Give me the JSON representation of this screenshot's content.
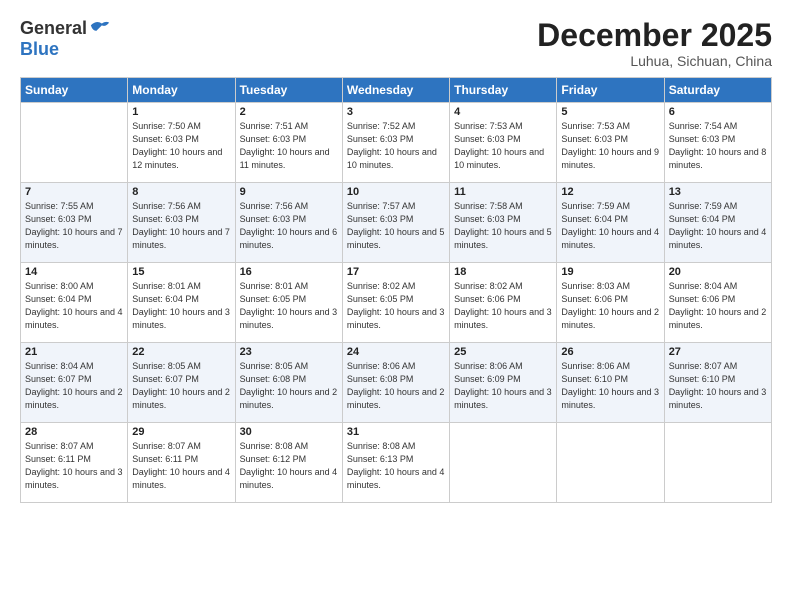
{
  "logo": {
    "general": "General",
    "blue": "Blue"
  },
  "title": "December 2025",
  "location": "Luhua, Sichuan, China",
  "headers": [
    "Sunday",
    "Monday",
    "Tuesday",
    "Wednesday",
    "Thursday",
    "Friday",
    "Saturday"
  ],
  "weeks": [
    [
      {
        "num": "",
        "sunrise": "",
        "sunset": "",
        "daylight": ""
      },
      {
        "num": "1",
        "sunrise": "Sunrise: 7:50 AM",
        "sunset": "Sunset: 6:03 PM",
        "daylight": "Daylight: 10 hours and 12 minutes."
      },
      {
        "num": "2",
        "sunrise": "Sunrise: 7:51 AM",
        "sunset": "Sunset: 6:03 PM",
        "daylight": "Daylight: 10 hours and 11 minutes."
      },
      {
        "num": "3",
        "sunrise": "Sunrise: 7:52 AM",
        "sunset": "Sunset: 6:03 PM",
        "daylight": "Daylight: 10 hours and 10 minutes."
      },
      {
        "num": "4",
        "sunrise": "Sunrise: 7:53 AM",
        "sunset": "Sunset: 6:03 PM",
        "daylight": "Daylight: 10 hours and 10 minutes."
      },
      {
        "num": "5",
        "sunrise": "Sunrise: 7:53 AM",
        "sunset": "Sunset: 6:03 PM",
        "daylight": "Daylight: 10 hours and 9 minutes."
      },
      {
        "num": "6",
        "sunrise": "Sunrise: 7:54 AM",
        "sunset": "Sunset: 6:03 PM",
        "daylight": "Daylight: 10 hours and 8 minutes."
      }
    ],
    [
      {
        "num": "7",
        "sunrise": "Sunrise: 7:55 AM",
        "sunset": "Sunset: 6:03 PM",
        "daylight": "Daylight: 10 hours and 7 minutes."
      },
      {
        "num": "8",
        "sunrise": "Sunrise: 7:56 AM",
        "sunset": "Sunset: 6:03 PM",
        "daylight": "Daylight: 10 hours and 7 minutes."
      },
      {
        "num": "9",
        "sunrise": "Sunrise: 7:56 AM",
        "sunset": "Sunset: 6:03 PM",
        "daylight": "Daylight: 10 hours and 6 minutes."
      },
      {
        "num": "10",
        "sunrise": "Sunrise: 7:57 AM",
        "sunset": "Sunset: 6:03 PM",
        "daylight": "Daylight: 10 hours and 5 minutes."
      },
      {
        "num": "11",
        "sunrise": "Sunrise: 7:58 AM",
        "sunset": "Sunset: 6:03 PM",
        "daylight": "Daylight: 10 hours and 5 minutes."
      },
      {
        "num": "12",
        "sunrise": "Sunrise: 7:59 AM",
        "sunset": "Sunset: 6:04 PM",
        "daylight": "Daylight: 10 hours and 4 minutes."
      },
      {
        "num": "13",
        "sunrise": "Sunrise: 7:59 AM",
        "sunset": "Sunset: 6:04 PM",
        "daylight": "Daylight: 10 hours and 4 minutes."
      }
    ],
    [
      {
        "num": "14",
        "sunrise": "Sunrise: 8:00 AM",
        "sunset": "Sunset: 6:04 PM",
        "daylight": "Daylight: 10 hours and 4 minutes."
      },
      {
        "num": "15",
        "sunrise": "Sunrise: 8:01 AM",
        "sunset": "Sunset: 6:04 PM",
        "daylight": "Daylight: 10 hours and 3 minutes."
      },
      {
        "num": "16",
        "sunrise": "Sunrise: 8:01 AM",
        "sunset": "Sunset: 6:05 PM",
        "daylight": "Daylight: 10 hours and 3 minutes."
      },
      {
        "num": "17",
        "sunrise": "Sunrise: 8:02 AM",
        "sunset": "Sunset: 6:05 PM",
        "daylight": "Daylight: 10 hours and 3 minutes."
      },
      {
        "num": "18",
        "sunrise": "Sunrise: 8:02 AM",
        "sunset": "Sunset: 6:06 PM",
        "daylight": "Daylight: 10 hours and 3 minutes."
      },
      {
        "num": "19",
        "sunrise": "Sunrise: 8:03 AM",
        "sunset": "Sunset: 6:06 PM",
        "daylight": "Daylight: 10 hours and 2 minutes."
      },
      {
        "num": "20",
        "sunrise": "Sunrise: 8:04 AM",
        "sunset": "Sunset: 6:06 PM",
        "daylight": "Daylight: 10 hours and 2 minutes."
      }
    ],
    [
      {
        "num": "21",
        "sunrise": "Sunrise: 8:04 AM",
        "sunset": "Sunset: 6:07 PM",
        "daylight": "Daylight: 10 hours and 2 minutes."
      },
      {
        "num": "22",
        "sunrise": "Sunrise: 8:05 AM",
        "sunset": "Sunset: 6:07 PM",
        "daylight": "Daylight: 10 hours and 2 minutes."
      },
      {
        "num": "23",
        "sunrise": "Sunrise: 8:05 AM",
        "sunset": "Sunset: 6:08 PM",
        "daylight": "Daylight: 10 hours and 2 minutes."
      },
      {
        "num": "24",
        "sunrise": "Sunrise: 8:06 AM",
        "sunset": "Sunset: 6:08 PM",
        "daylight": "Daylight: 10 hours and 2 minutes."
      },
      {
        "num": "25",
        "sunrise": "Sunrise: 8:06 AM",
        "sunset": "Sunset: 6:09 PM",
        "daylight": "Daylight: 10 hours and 3 minutes."
      },
      {
        "num": "26",
        "sunrise": "Sunrise: 8:06 AM",
        "sunset": "Sunset: 6:10 PM",
        "daylight": "Daylight: 10 hours and 3 minutes."
      },
      {
        "num": "27",
        "sunrise": "Sunrise: 8:07 AM",
        "sunset": "Sunset: 6:10 PM",
        "daylight": "Daylight: 10 hours and 3 minutes."
      }
    ],
    [
      {
        "num": "28",
        "sunrise": "Sunrise: 8:07 AM",
        "sunset": "Sunset: 6:11 PM",
        "daylight": "Daylight: 10 hours and 3 minutes."
      },
      {
        "num": "29",
        "sunrise": "Sunrise: 8:07 AM",
        "sunset": "Sunset: 6:11 PM",
        "daylight": "Daylight: 10 hours and 4 minutes."
      },
      {
        "num": "30",
        "sunrise": "Sunrise: 8:08 AM",
        "sunset": "Sunset: 6:12 PM",
        "daylight": "Daylight: 10 hours and 4 minutes."
      },
      {
        "num": "31",
        "sunrise": "Sunrise: 8:08 AM",
        "sunset": "Sunset: 6:13 PM",
        "daylight": "Daylight: 10 hours and 4 minutes."
      },
      {
        "num": "",
        "sunrise": "",
        "sunset": "",
        "daylight": ""
      },
      {
        "num": "",
        "sunrise": "",
        "sunset": "",
        "daylight": ""
      },
      {
        "num": "",
        "sunrise": "",
        "sunset": "",
        "daylight": ""
      }
    ]
  ]
}
